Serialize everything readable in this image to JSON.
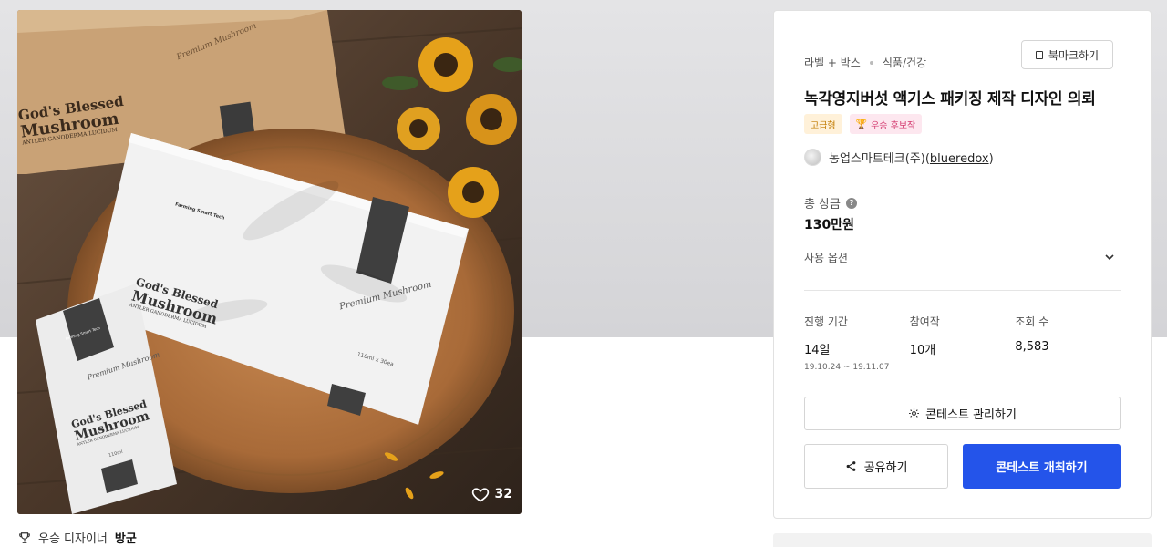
{
  "artwork": {
    "like_count": "32",
    "icons": {
      "like": "heart-icon"
    },
    "overlay_text": {
      "box_title_line1": "God's Blessed",
      "box_title_line2": "Mushroom",
      "box_subtitle": "ANTLER GANODERMA LUCIDUM",
      "brand": "Farming Smart Tech",
      "script_label": "Premium Mushroom",
      "box_size": "110ml x 30ea",
      "pouch_size": "110ml"
    }
  },
  "winner": {
    "icon": "trophy-icon",
    "label": "우승 디자이너",
    "name": "방군"
  },
  "panel": {
    "category_main": "라벨 + 박스",
    "category_sub": "식품/건강",
    "bookmark_label": "북마크하기",
    "title": "녹각영지버섯 액기스 패키징 제작 디자인 의뢰",
    "badges": {
      "premium": "고급형",
      "winner": "우승 후보작"
    },
    "host": {
      "company": "농업스마트테크(주)",
      "handle_open": "(",
      "handle": "blueredox",
      "handle_close": ")"
    },
    "prize": {
      "label": "총 상금",
      "help": "?",
      "value": "130만원"
    },
    "options_label": "사용 옵션",
    "stats": {
      "period_label": "진행 기간",
      "period_value": "14일",
      "period_dates": "19.10.24 ~ 19.11.07",
      "entries_label": "참여작",
      "entries_value": "10개",
      "views_label": "조회 수",
      "views_value": "8,583"
    },
    "manage_button": "콘테스트 관리하기",
    "share_button": "공유하기",
    "host_button": "콘테스트 개최하기"
  },
  "colors": {
    "primary": "#2454ea",
    "premium_badge_bg": "#fff1d9",
    "premium_badge_text": "#c27b00",
    "winner_badge_bg": "#fde7ef",
    "winner_badge_text": "#d43a6f"
  }
}
